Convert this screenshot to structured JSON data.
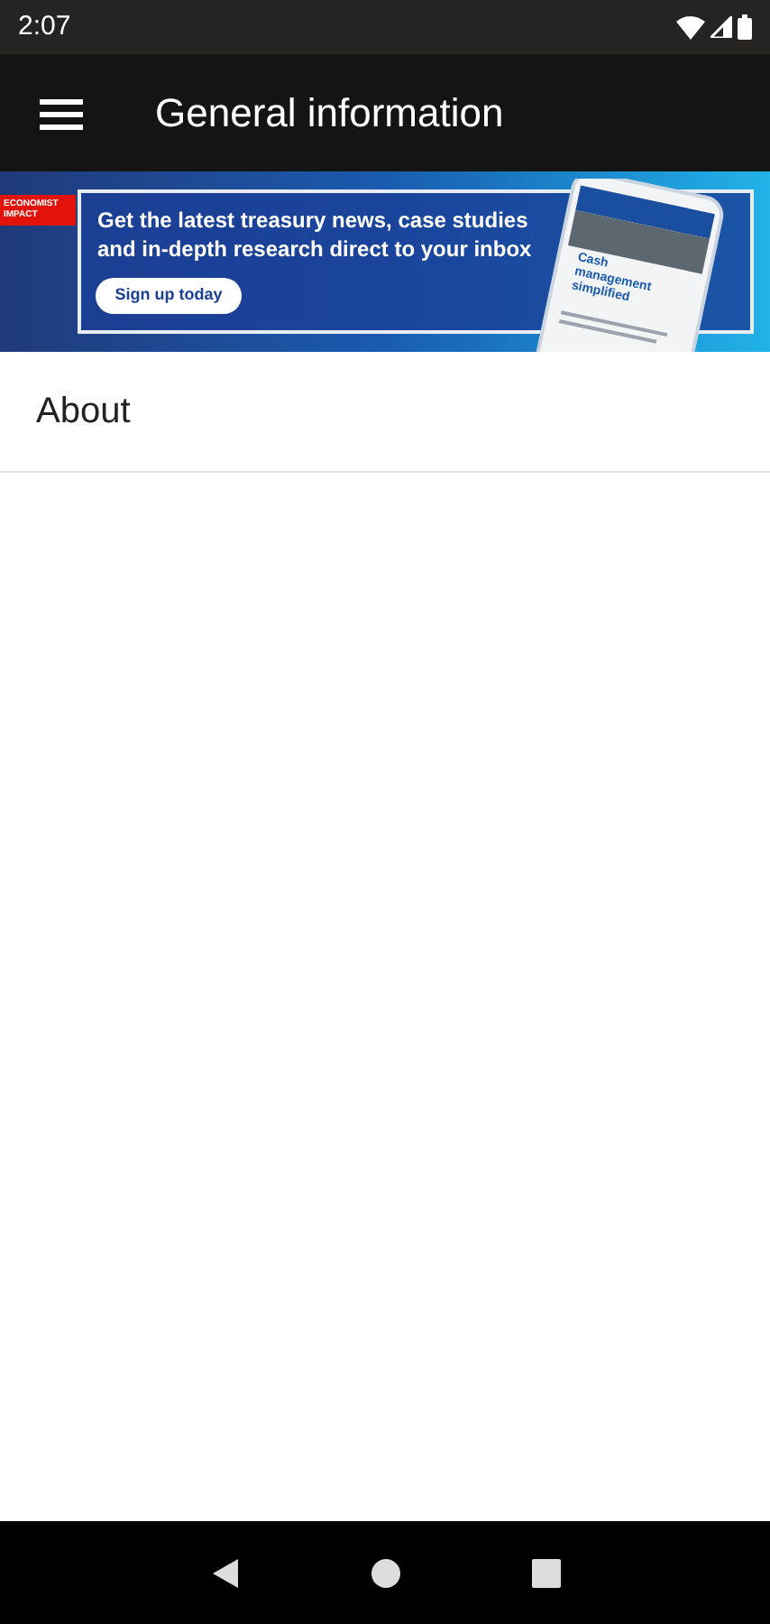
{
  "status_bar": {
    "time": "2:07"
  },
  "app_bar": {
    "title": "General information"
  },
  "banner": {
    "brand": "ECONOMIST IMPACT",
    "headline": "Get the latest treasury news, case studies and in-depth research direct to your inbox",
    "button": "Sign up today",
    "phone_headline": "Cash management simplified"
  },
  "list": [
    {
      "label": "About"
    }
  ]
}
